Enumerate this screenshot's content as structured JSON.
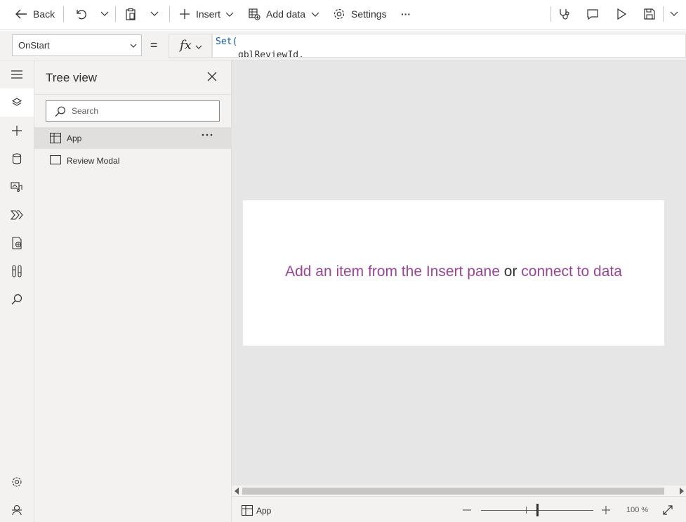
{
  "toolbar": {
    "back_label": "Back",
    "insert_label": "Insert",
    "add_data_label": "Add data",
    "settings_label": "Settings",
    "more_label": "···"
  },
  "formula_bar": {
    "property": "OnStart",
    "equals": "=",
    "fx_label": "fx",
    "line1": "Set(",
    "line2": "gblReviewId,"
  },
  "tree_view": {
    "title": "Tree view",
    "search_placeholder": "Search",
    "nodes": [
      {
        "label": "App",
        "selected": true,
        "icon": "app-icon"
      },
      {
        "label": "Review Modal",
        "selected": false,
        "icon": "screen-icon"
      }
    ]
  },
  "canvas": {
    "hint_part1": "Add an item from the Insert pane",
    "hint_or": "or",
    "hint_part2": "connect to data"
  },
  "status_bar": {
    "selected_label": "App",
    "zoom": "100 %",
    "zoom_percent": 100
  },
  "rail": {
    "icons": [
      "hamburger-icon",
      "layers-icon",
      "plus-icon",
      "data-icon",
      "media-icon",
      "power-automate-icon",
      "advanced-tools-icon",
      "variables-icon",
      "search-icon",
      "settings-icon",
      "virtual-agent-icon"
    ]
  },
  "colors": {
    "accent_link": "#9b4497",
    "formula_keyword": "#0b5cad",
    "canvas_bg": "#e6e6e6"
  }
}
